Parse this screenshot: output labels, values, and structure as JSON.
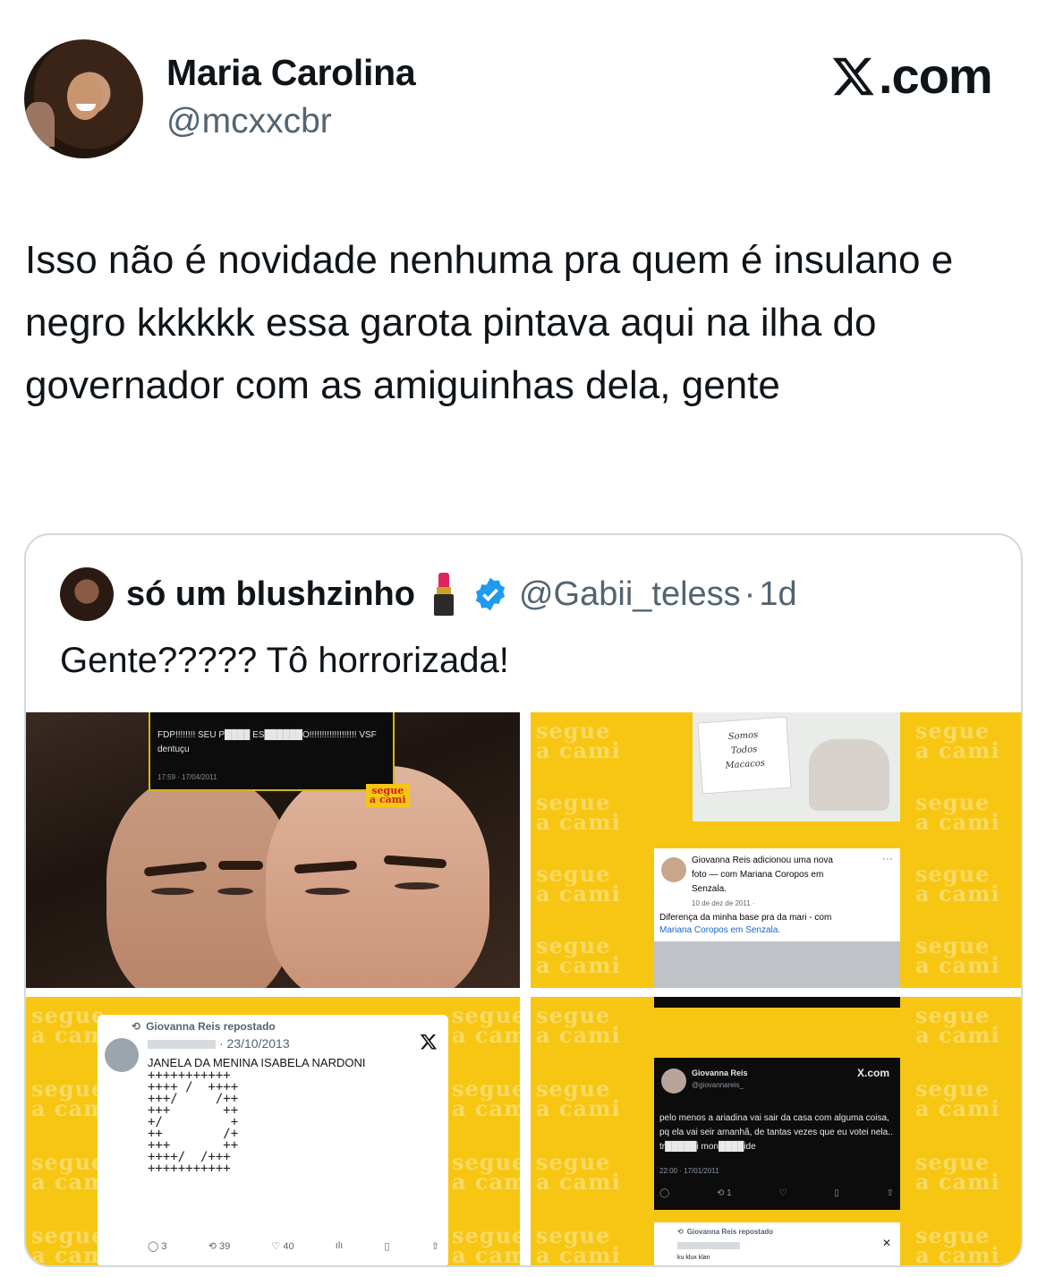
{
  "author": {
    "name": "Maria Carolina",
    "handle": "@mcxxcbr"
  },
  "brand": {
    "label": ".com"
  },
  "tweet": {
    "text": "Isso não é novidade nenhuma pra quem é insulano e negro kkkkkk essa garota pintava aqui na ilha do governador com as amiguinhas dela, gente"
  },
  "quote": {
    "name": "só um blushzinho",
    "handle": "@Gabii_teless",
    "time": "1d",
    "separator": "·",
    "text": "Gente????? Tô horrorizada!"
  },
  "watermark": {
    "line1": "segue",
    "line2": "a cami"
  },
  "image1": {
    "line1": "FDP!!!!!!!! SEU P████ ES██████O!!!!!!!!!!!!!!!!!!! VSF",
    "line2": "dentuçu",
    "time": "17:59 · 17/04/2011",
    "badge1": "segue",
    "badge2": "a cami"
  },
  "image2": {
    "sign1": "Somos",
    "sign2": "Todos",
    "sign3": "Macacos",
    "line1": "Giovanna Reis adicionou uma nova",
    "line2": "foto — com Mariana Coropos em",
    "line3": "Senzala.",
    "date": "10 de dez de 2011 · ",
    "dots": "···",
    "body1": "Diferença da minha base pra da mari - com",
    "body2": "Mariana Coropos em Senzala."
  },
  "image3": {
    "reposted": "Giovanna Reis repostado",
    "date": "· 23/10/2013",
    "title": "JANELA DA MENINA ISABELA NARDONI",
    "art": "+++++++++++\n++++ /  ++++\n+++/     /++\n+++       ++\n+/         +\n++        /+\n+++       ++\n++++/  /+++\n+++++++++++",
    "replies": "3",
    "reposts": "39",
    "likes": "40"
  },
  "image4": {
    "name": "Giovanna Reis",
    "handle": "@giovannareis_",
    "brand": "X.com",
    "text": "pelo menos a ariadina vai sair da casa com alguma coisa, pq ela vai seir amanhã, de tantas vezes que eu votei nela.. tr█████i mon████ide",
    "time": "22:00 · 17/01/2011",
    "reposts": "1",
    "reposted": "Giovanna Reis repostado",
    "footer": "ku klux klan"
  }
}
